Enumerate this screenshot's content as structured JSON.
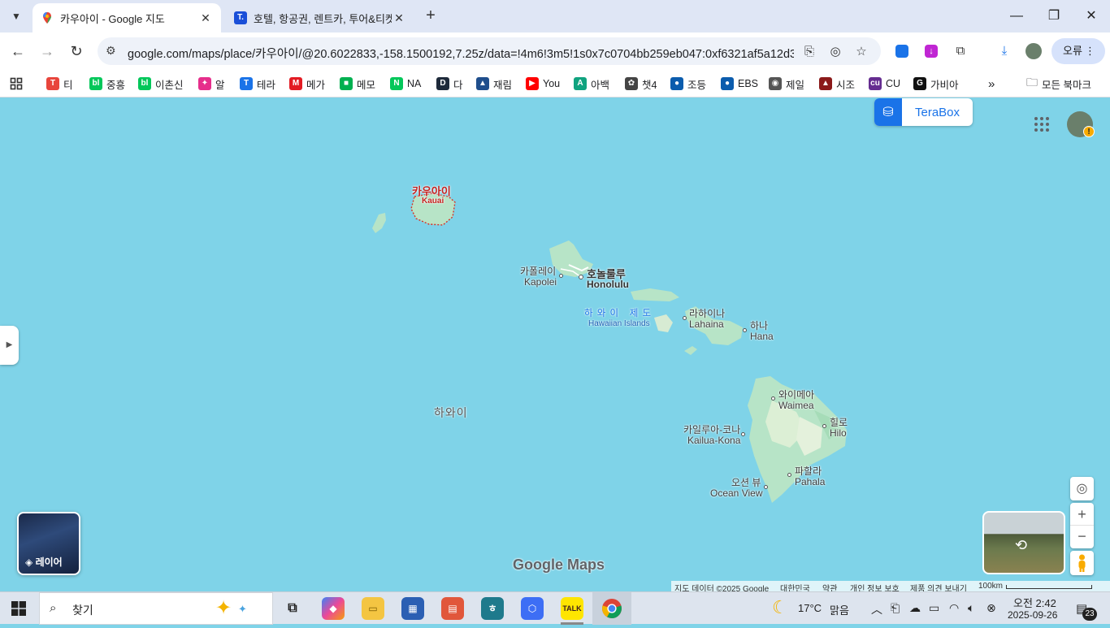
{
  "tabs": [
    {
      "title": "카우아이 - Google 지도",
      "active": true
    },
    {
      "title": "호텔, 항공권, 렌트카, 투어&티켓",
      "active": false
    }
  ],
  "toolbar": {
    "url": "google.com/maps/place/카우아이/@20.6022833,-158.1500192,7.25z/data=!4m6!3m5!1s0x7c0704bb259eb047:0xf6321af5a12d3...",
    "profile_label": "오류"
  },
  "bookmarks": [
    {
      "label": "티",
      "color": "#e8453c",
      "glyph": "T"
    },
    {
      "label": "중흥",
      "color": "#03c75a",
      "glyph": "bl"
    },
    {
      "label": "이촌신",
      "color": "#03c75a",
      "glyph": "bl"
    },
    {
      "label": "알",
      "color": "#e62e8b",
      "glyph": "✦"
    },
    {
      "label": "테라",
      "color": "#1a73e8",
      "glyph": "T"
    },
    {
      "label": "메가",
      "color": "#e31b23",
      "glyph": "M"
    },
    {
      "label": "메모",
      "color": "#00b050",
      "glyph": "■"
    },
    {
      "label": "NA",
      "color": "#03c75a",
      "glyph": "N"
    },
    {
      "label": "다",
      "color": "#1e2a3a",
      "glyph": "D"
    },
    {
      "label": "재림",
      "color": "#1f4e8c",
      "glyph": "▲"
    },
    {
      "label": "You",
      "color": "#ff0000",
      "glyph": "▶"
    },
    {
      "label": "아백",
      "color": "#10a37f",
      "glyph": "A"
    },
    {
      "label": "챗4",
      "color": "#444444",
      "glyph": "✿"
    },
    {
      "label": "조등",
      "color": "#0b5cad",
      "glyph": "●"
    },
    {
      "label": "EBS",
      "color": "#0b5cad",
      "glyph": "●"
    },
    {
      "label": "제일",
      "color": "#555555",
      "glyph": "◉"
    },
    {
      "label": "시조",
      "color": "#8b1a1a",
      "glyph": "▲"
    },
    {
      "label": "CU",
      "color": "#652d90",
      "glyph": "cu"
    },
    {
      "label": "가비아",
      "color": "#111111",
      "glyph": "G"
    }
  ],
  "bookmarks_more": "»",
  "all_bookmarks": "모든 북마크",
  "map": {
    "terabox_label": "TeraBox",
    "layers_label": "레이어",
    "logo": "Google Maps",
    "labels": {
      "kauai_ko": "카우아이",
      "kauai_en": "Kauai",
      "kapolei_ko": "카폴레이",
      "kapolei_en": "Kapolei",
      "honolulu_ko": "호놀룰루",
      "honolulu_en": "Honolulu",
      "islands_ko": "하 와 이   제 도",
      "islands_en": "Hawaiian Islands",
      "lahaina_ko": "라하이나",
      "lahaina_en": "Lahaina",
      "hana_ko": "하나",
      "hana_en": "Hana",
      "hawaii_ko": "하와이",
      "waimea_ko": "와이메아",
      "waimea_en": "Waimea",
      "hilo_ko": "힐로",
      "hilo_en": "Hilo",
      "kona_ko": "카일루아-코나",
      "kona_en": "Kailua-Kona",
      "pahala_ko": "파할라",
      "pahala_en": "Pahala",
      "oceanview_ko": "오션 뷰",
      "oceanview_en": "Ocean View"
    },
    "footer": {
      "data": "지도 데이터 ©2025 Google",
      "country": "대한민국",
      "terms": "약관",
      "privacy": "개인 정보 보호",
      "feedback": "제품 의견 보내기",
      "scale": "100km"
    },
    "zoom_in": "+",
    "zoom_out": "−"
  },
  "taskbar": {
    "search_label": "찾기",
    "weather_temp": "17°C",
    "weather_desc": "맑음",
    "time": "오전 2:42",
    "date": "2025-09-26",
    "notif_count": "23"
  }
}
